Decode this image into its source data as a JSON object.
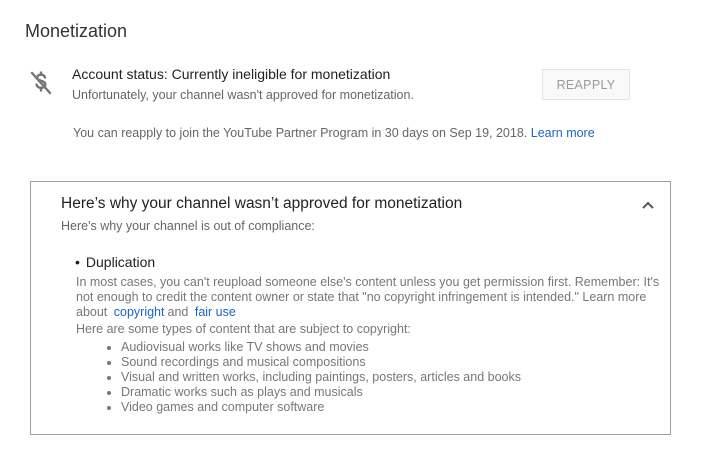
{
  "header": {
    "title": "Monetization"
  },
  "status": {
    "icon": "money-off-icon",
    "title": "Account status: Currently ineligible for monetization",
    "subtitle": "Unfortunately, your channel wasn't approved for monetization.",
    "reapply_label": "REAPPLY",
    "note_text": "You can reapply to join the YouTube Partner Program in 30 days on Sep 19, 2018.",
    "learn_more": "Learn more"
  },
  "panel": {
    "title": "Here’s why your channel wasn’t approved for monetization",
    "subtitle": "Here's why your channel is out of compliance:",
    "chevron_icon": "chevron-up-icon",
    "reason": {
      "title": "Duplication",
      "body": "In most cases, you can't reupload someone else's content unless you get permission first. Remember: It's not enough to credit the content owner or state that \"no copyright infringement is intended.\" Learn more about",
      "link_copyright": "copyright",
      "and_text": "and",
      "link_fair_use": "fair use",
      "intro": "Here are some types of content that are subject to copyright:",
      "types": [
        "Audiovisual works like TV shows and movies",
        "Sound recordings and musical compositions",
        "Visual and written works, including paintings, posters, articles and books",
        "Dramatic works such as plays and musicals",
        "Video games and computer software"
      ]
    }
  },
  "colors": {
    "link": "#1a65c7",
    "border": "#9e9e9e"
  }
}
